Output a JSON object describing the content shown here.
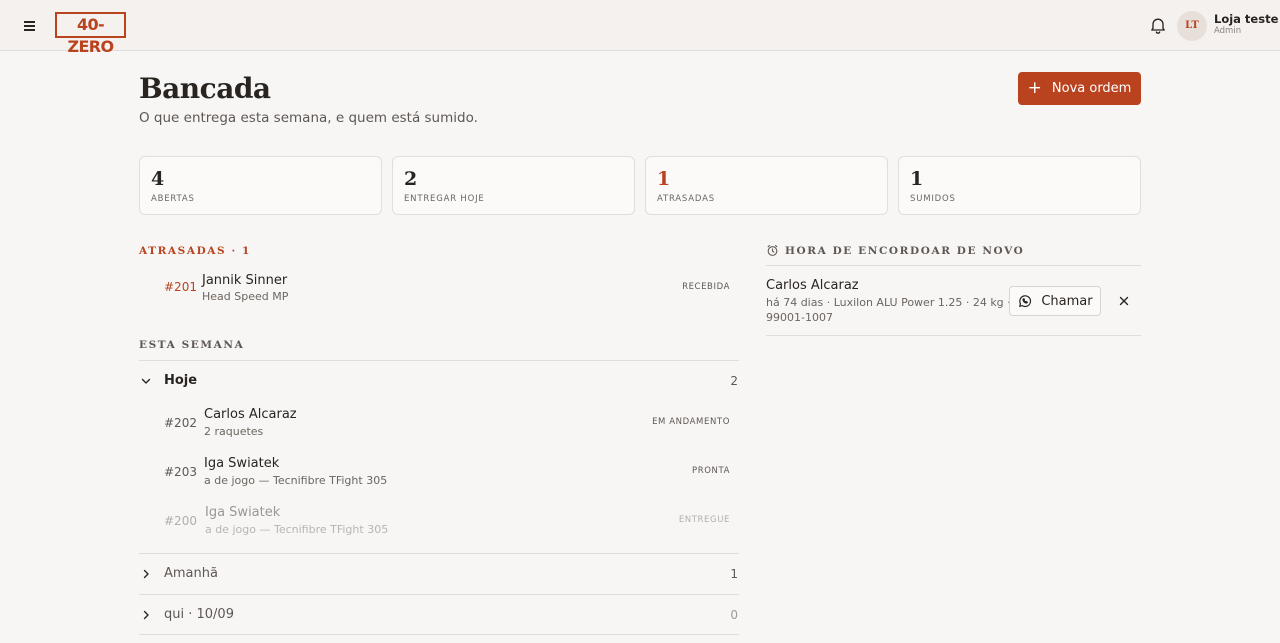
{
  "header": {
    "logo": "40-ZERO",
    "user": {
      "initials": "LT",
      "name": "Loja teste",
      "role": "Admin"
    }
  },
  "page": {
    "title": "Bancada",
    "subtitle": "O que entrega esta semana, e quem está sumido.",
    "new_order_label": "Nova ordem"
  },
  "stats": [
    {
      "value": "4",
      "label": "ABERTAS"
    },
    {
      "value": "2",
      "label": "ENTREGAR HOJE"
    },
    {
      "value": "1",
      "label": "ATRASADAS"
    },
    {
      "value": "1",
      "label": "SUMIDOS"
    }
  ],
  "overdue": {
    "heading": "ATRASADAS · 1",
    "items": [
      {
        "id": "#201",
        "name": "Jannik Sinner",
        "detail": "Head Speed MP",
        "status": "RECEBIDA"
      }
    ]
  },
  "week": {
    "heading": "ESTA SEMANA",
    "groups": [
      {
        "label": "Hoje",
        "count": "2",
        "expanded": true,
        "items": [
          {
            "id": "#202",
            "name": "Carlos Alcaraz",
            "detail": "2 raquetes",
            "status": "EM ANDAMENTO"
          },
          {
            "id": "#203",
            "name": "Iga Swiatek",
            "detail": "a de jogo — Tecnifibre TFight 305",
            "status": "PRONTA"
          },
          {
            "id": "#200",
            "name": "Iga Swiatek",
            "detail": "a de jogo — Tecnifibre TFight 305",
            "status": "ENTREGUE"
          }
        ]
      },
      {
        "label": "Amanhã",
        "count": "1",
        "expanded": false
      },
      {
        "label": "qui · 10/09",
        "count": "0",
        "expanded": false
      }
    ]
  },
  "restring": {
    "heading": "HORA DE ENCORDOAR DE NOVO",
    "items": [
      {
        "name": "Carlos Alcaraz",
        "detail_line1": "há 74 dias · Luxilon ALU Power 1.25 · 24 kg · (48)",
        "detail_line2": "99001-1007",
        "action_label": "Chamar"
      }
    ]
  },
  "colors": {
    "accent": "#b9431f",
    "background": "#f7f6f5",
    "border": "#e2ddd9"
  }
}
